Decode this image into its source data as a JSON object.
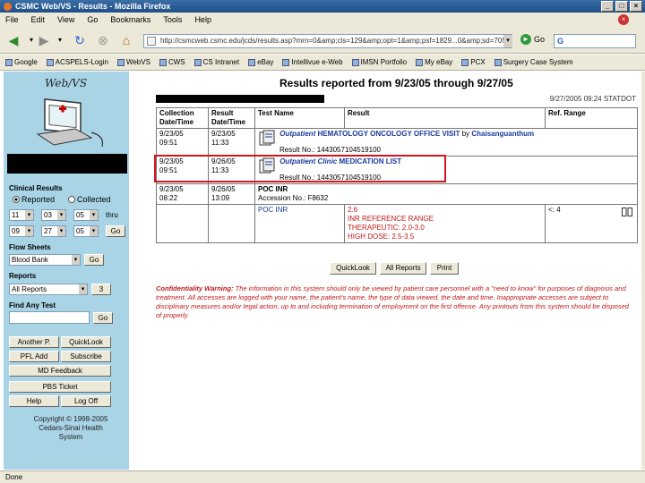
{
  "window": {
    "title": "CSMC Web/VS - Results - Mozilla Firefox"
  },
  "menu": [
    "File",
    "Edit",
    "View",
    "Go",
    "Bookmarks",
    "Tools",
    "Help"
  ],
  "nav": {
    "url": "http://csmcweb.csmc.edu/jcds/results.asp?mrn=0&amp;cls=129&amp;opt=1&amp;psf=1829...0&amp;sd=705e1791",
    "go_label": "Go",
    "search_label": "G"
  },
  "bookmarks": [
    "Google",
    "ACSPELS-Login",
    "WebVS",
    "CWS",
    "CS Intranet",
    "eBay",
    "Intellivue e-Web",
    "IMSN Portfolio",
    "My eBay",
    "PCX",
    "Surgery Case System"
  ],
  "sidebar": {
    "logo": "Web/VS",
    "clinical_results_label": "Clinical Results",
    "radio_reported": "Reported",
    "radio_collected": "Collected",
    "from_date": [
      "11",
      "03",
      "05"
    ],
    "thru_label": "thru",
    "to_date": [
      "09",
      "27",
      "05"
    ],
    "go_label": "Go",
    "flow_sheets_label": "Flow Sheets",
    "flow_sheets_value": "Blood Bank",
    "flow_go": "Go",
    "reports_label": "Reports",
    "reports_value": "All Reports",
    "reports_go": "3",
    "find_any_test_label": "Find Any Test",
    "find_go": "Go",
    "buttons": [
      "Another P.",
      "QuickLook",
      "PFL Add",
      "Subscribe",
      "MD Feedback",
      "PBS Ticket",
      "Help",
      "Log Off"
    ],
    "copyright": "Copyright © 1998-2005 Cedars-Sinai Health System"
  },
  "main": {
    "heading": "Results reported from 9/23/05 through 9/27/05",
    "datestamp": "9/27/2005 09:24 STATDOT",
    "columns": [
      "Collection Date/Time",
      "Result Date/Time",
      "Test Name",
      "Result",
      "Ref. Range"
    ],
    "rows": [
      {
        "cdate": "9/23/05",
        "ctime": "09:51",
        "rdate": "9/23/05",
        "rtime": "11:33",
        "doc_type": "Outpatient",
        "doc_title": "HEMATOLOGY ONCOLOGY OFFICE VISIT",
        "by": "by",
        "author": "Chaisanguanthum",
        "result_no": "Result No.: 1443057104519100"
      },
      {
        "cdate": "9/23/05",
        "ctime": "09:51",
        "rdate": "9/26/05",
        "rtime": "11:33",
        "doc_type": "Outpatient Clinic",
        "doc_title": "MEDICATION LIST",
        "result_no": "Result No.: 1443057104519100"
      },
      {
        "cdate": "9/23/05",
        "ctime": "08:22",
        "rdate": "9/26/05",
        "rtime": "13:09",
        "test": "POC INR",
        "accession": "Accession No.: F8632",
        "test_link": "POC INR",
        "values": [
          "2.6",
          "INR REFERENCE RANGE",
          "THERAPEUTIC: 2.0-3.0",
          "HIGH DOSE: 2.5-3.5"
        ],
        "ref": "<: 4"
      }
    ],
    "buttons": [
      "QuickLook",
      "All Reports",
      "Print"
    ],
    "warning_title": "Confidentiality Warning:",
    "warning_body": "The information in this system should only be viewed by patient care personnel with a \"need to know\" for purposes of diagnosis and treatment. All accesses are logged with your name, the patient's name, the type of data viewed, the date and time. Inappropriate accesses are subject to disciplinary measures and/or legal action, up to and including termination of employment on the first offense. Any printouts from this system should be disposed of properly."
  },
  "status": "Done",
  "colors": {
    "sidebar": "#a9d4e6",
    "highlight": "#d0161c",
    "link": "#1a3a9c",
    "alert": "#c01818"
  }
}
